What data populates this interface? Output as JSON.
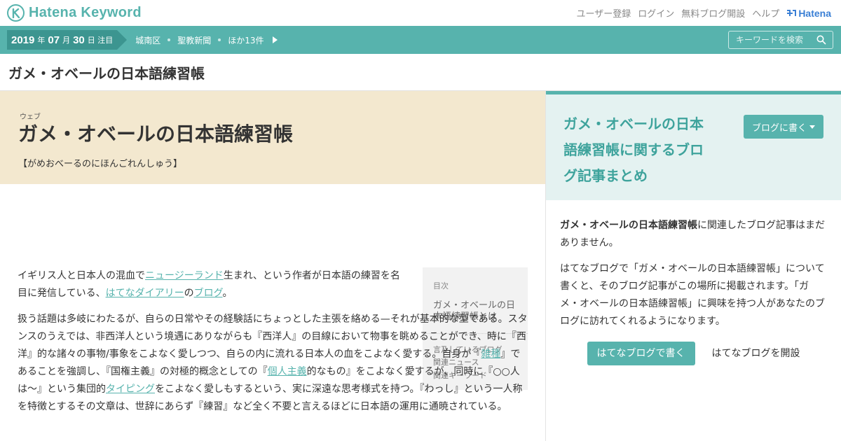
{
  "header": {
    "logo_text": "Hatena Keyword",
    "links": [
      "ユーザー登録",
      "ログイン",
      "無料ブログ開設",
      "ヘルプ"
    ],
    "brand": "Hatena"
  },
  "trend_bar": {
    "year": "2019",
    "year_unit": "年",
    "month": "07",
    "month_unit": "月",
    "day": "30",
    "day_unit": "日 注目",
    "items": [
      "城南区",
      "聖教新聞",
      "ほか13件"
    ],
    "search_placeholder": "キーワードを検索"
  },
  "page_title": "ガメ・オベールの日本語練習帳",
  "keyword": {
    "category": "ウェブ",
    "title": "ガメ・オベールの日本語練習帳",
    "reading": "【がめおべーるのにほんごれんしゅう】"
  },
  "toc": {
    "label": "目次",
    "main": "ガメ・オベールの日本語練習帳とは",
    "sub": [
      "言及しているブログ",
      "関連ニュース",
      "関連キーワード"
    ]
  },
  "article": {
    "p1": {
      "t1": "イギリス人と日本人の混血で",
      "l1": "ニュージーランド",
      "t2": "生まれ、という作者が日本語の練習を名目に発信している、",
      "l2": "はてなダイアリー",
      "t3": "の",
      "l3": "ブログ",
      "t4": "。"
    },
    "p2": {
      "t1": "扱う話題は多岐にわたるが、自らの日常やその経験話にちょっとした主張を絡める—それが基本的な型である。スタンスのうえでは、非西洋人という境遇にありながらも『西洋人』の目線において物事を眺めることができ、時に『西洋』的な諸々の事物/事象をこよなく愛しつつ、自らの内に流れる日本人の血をこよなく愛する。自身が『",
      "l1": "雑種",
      "t2": "』であることを強調し、『国権主義』の対極的概念としての『",
      "l2": "個人主義",
      "t3": "的なもの』をこよなく愛するが、同時に『○○人は～』という集団的",
      "l3": "タイピング",
      "t4": "をこよなく愛しもするという、実に深遠な思考様式を持つ。『わっし』という一人称を特徴とするその文章は、世辞にあらず『練習』など全く不要と言えるほどに日本語の運用に通暁されている。"
    }
  },
  "sidebar": {
    "summary_title": "ガメ・オベールの日本語練習帳に関するブログ記事まとめ",
    "write_button": "ブログに書く",
    "body1_bold": "ガメ・オベールの日本語練習帳",
    "body1_rest": "に関連したブログ記事はまだありません。",
    "body2": "はてなブログで「ガメ・オベールの日本語練習帳」について書くと、そのブログ記事がこの場所に掲載されます。「ガメ・オベールの日本語練習帳」に興味を持つ人があなたのブログに訪れてくれるようになります。",
    "primary_button": "はてなブログで書く",
    "open_link": "はてなブログを開設"
  },
  "colors": {
    "accent": "#57b3ad",
    "accent_dark": "#3c9590",
    "keyword_bg": "#f3e8cf",
    "summary_bg": "#e4f2f1",
    "brand_blue": "#3a7fd5"
  }
}
